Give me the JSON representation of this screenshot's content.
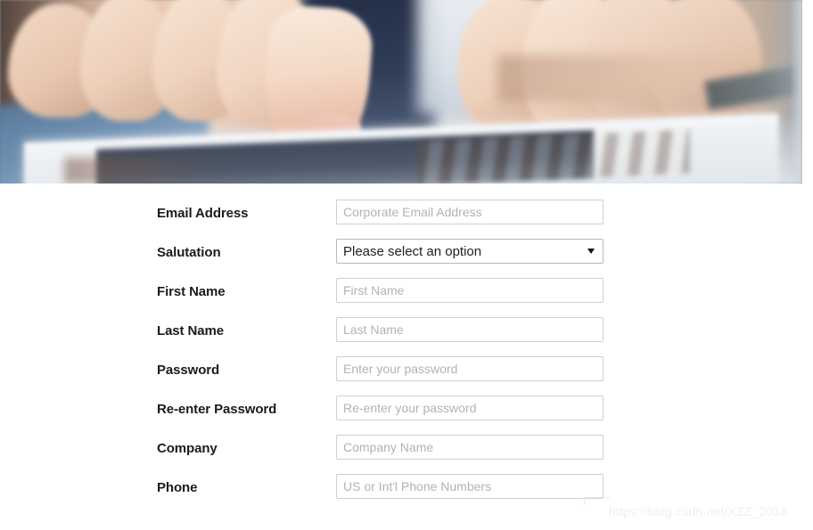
{
  "hero": {
    "alt_description": "Blurred photograph of two hands using a tablet on a desk",
    "dominant_colors": {
      "skin": "#eccdb6",
      "navy": "#22304c",
      "desk_blue": "#5d83aa",
      "tablet": "#e9edf1"
    }
  },
  "form": {
    "rows": [
      {
        "label": "Email Address",
        "type": "text",
        "placeholder": "Corporate Email Address",
        "value": "",
        "name": "email-address"
      },
      {
        "label": "Salutation",
        "type": "select",
        "selected": "Please select an option",
        "name": "salutation"
      },
      {
        "label": "First Name",
        "type": "text",
        "placeholder": "First Name",
        "value": "",
        "name": "first-name"
      },
      {
        "label": "Last Name",
        "type": "text",
        "placeholder": "Last Name",
        "value": "",
        "name": "last-name"
      },
      {
        "label": "Password",
        "type": "password",
        "placeholder": "Enter your password",
        "value": "",
        "name": "password"
      },
      {
        "label": "Re-enter Password",
        "type": "password",
        "placeholder": "Re-enter your password",
        "value": "",
        "name": "reenter-password"
      },
      {
        "label": "Company",
        "type": "text",
        "placeholder": "Company Name",
        "value": "",
        "name": "company"
      },
      {
        "label": "Phone",
        "type": "text",
        "placeholder": "US or Int'l Phone Numbers",
        "value": "",
        "name": "phone"
      }
    ]
  },
  "watermark": {
    "text": "https://blog.csdn.net/XZZ_2018",
    "color": "#f0f0f0"
  },
  "colors": {
    "label_text": "#1b1b1b",
    "placeholder": "#b3b3b3",
    "input_border": "#cfcfcf",
    "select_border": "#b9b9b9",
    "page_background": "#ffffff"
  }
}
